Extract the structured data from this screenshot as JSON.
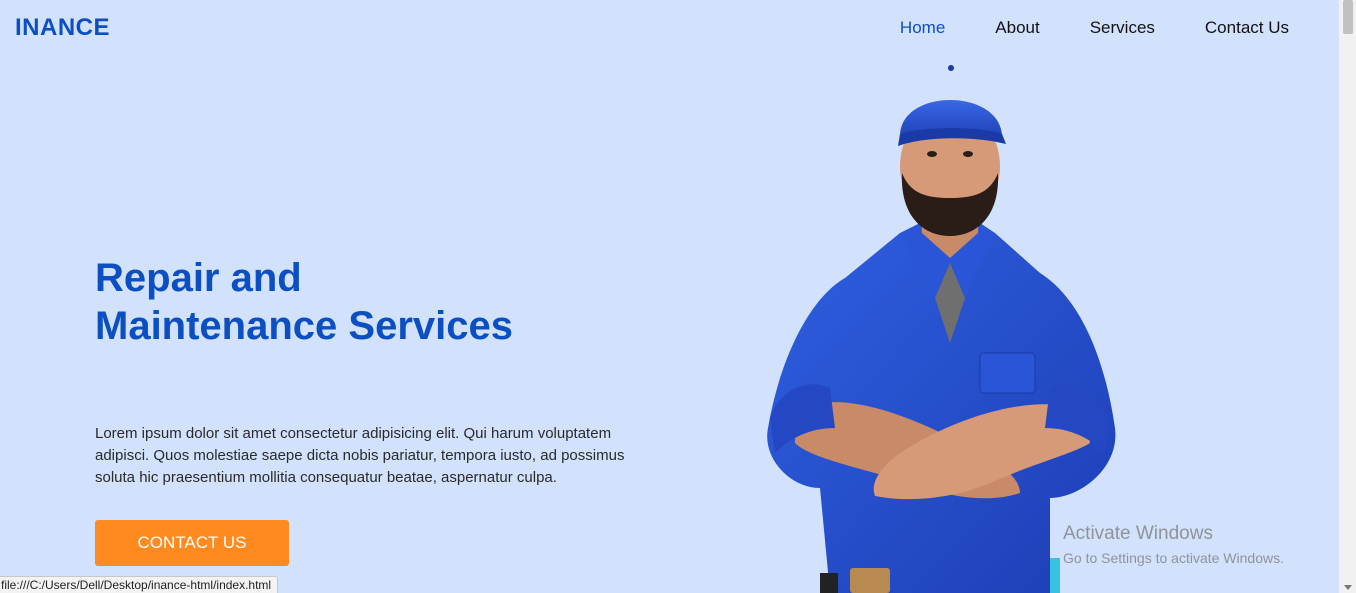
{
  "brand": {
    "logo": "INANCE"
  },
  "nav": {
    "items": [
      {
        "label": "Home",
        "active": true
      },
      {
        "label": "About",
        "active": false
      },
      {
        "label": "Services",
        "active": false
      },
      {
        "label": "Contact Us",
        "active": false
      }
    ]
  },
  "hero": {
    "title": "Repair and Maintenance Services",
    "description": "Lorem ipsum dolor sit amet consectetur adipisicing elit. Qui harum voluptatem adipisci. Quos molestiae saepe dicta nobis pariatur, tempora iusto, ad possimus soluta hic praesentium mollitia consequatur beatae, aspernatur culpa.",
    "cta_label": "CONTACT US"
  },
  "status_bar": {
    "url": "file:///C:/Users/Dell/Desktop/inance-html/index.html"
  },
  "watermark": {
    "line1": "Activate Windows",
    "line2": "Go to Settings to activate Windows."
  },
  "colors": {
    "background": "#d2e2fd",
    "brand_blue": "#0c4fc2",
    "cta_orange": "#ff8a1f"
  },
  "icons": [
    "worker-illustration",
    "scroll-down-arrow-icon"
  ]
}
